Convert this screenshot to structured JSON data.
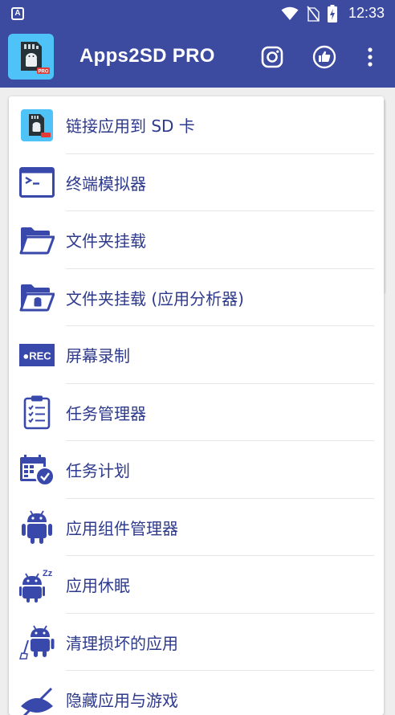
{
  "status_bar": {
    "notification_letter": "A",
    "time": "12:33"
  },
  "app_bar": {
    "title": "Apps2SD PRO",
    "logo_badge": "PRO",
    "icons": [
      "instagram-icon",
      "thumbs-up-icon",
      "more-vert-icon"
    ]
  },
  "menu": {
    "items": [
      {
        "label": "链接应用到 SD 卡",
        "icon": "apps2sd-logo-icon"
      },
      {
        "label": "终端模拟器",
        "icon": "terminal-icon"
      },
      {
        "label": "文件夹挂载",
        "icon": "folder-open-icon"
      },
      {
        "label": "文件夹挂载 (应用分析器)",
        "icon": "folder-android-icon"
      },
      {
        "label": "屏幕录制",
        "icon": "rec-icon",
        "icon_text": "●REC"
      },
      {
        "label": "任务管理器",
        "icon": "clipboard-icon"
      },
      {
        "label": "任务计划",
        "icon": "calendar-clock-icon"
      },
      {
        "label": "应用组件管理器",
        "icon": "android-icon"
      },
      {
        "label": "应用休眠",
        "icon": "android-sleep-icon",
        "icon_text": "Zz"
      },
      {
        "label": "清理损坏的应用",
        "icon": "android-broom-icon"
      },
      {
        "label": "隐藏应用与游戏",
        "icon": "hide-icon"
      }
    ]
  },
  "colors": {
    "primary": "#3c4a9f",
    "icon_blue": "#3949ab",
    "text_blue": "#2e3a8c",
    "logo_bg": "#4fc3f7",
    "badge_red": "#e53935"
  }
}
